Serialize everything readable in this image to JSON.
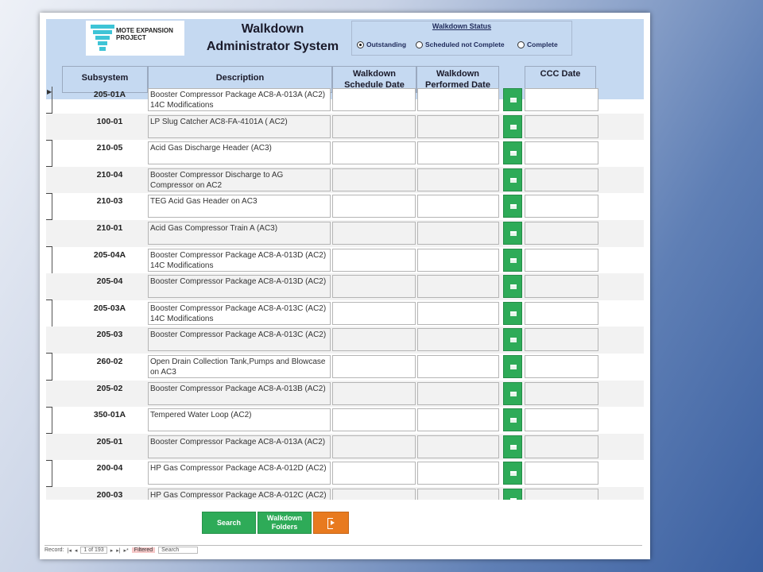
{
  "header": {
    "logo_line1": "MOTE EXPANSION",
    "logo_line2": "PROJECT",
    "title_line1": "Walkdown",
    "title_line2": "Administrator System"
  },
  "status": {
    "title": "Walkdown Status",
    "options": [
      {
        "label": "Outstanding",
        "selected": true
      },
      {
        "label": "Scheduled not Complete",
        "selected": false
      },
      {
        "label": "Complete",
        "selected": false
      }
    ]
  },
  "columns": {
    "subsystem": "Subsystem",
    "description": "Description",
    "schedule_l1": "Walkdown",
    "schedule_l2": "Schedule Date",
    "performed_l1": "Walkdown",
    "performed_l2": "Performed Date",
    "ccc": "CCC Date"
  },
  "rows": [
    {
      "subsystem": "205-01A",
      "description": "Booster Compressor Package AC8-A-013A (AC2) 14C Modifications"
    },
    {
      "subsystem": "100-01",
      "description": "LP Slug Catcher AC8-FA-4101A ( AC2)"
    },
    {
      "subsystem": "210-05",
      "description": "Acid Gas Discharge Header  (AC3)"
    },
    {
      "subsystem": "210-04",
      "description": "Booster Compressor Discharge to AG Compressor on AC2"
    },
    {
      "subsystem": "210-03",
      "description": "TEG Acid Gas Header on AC3"
    },
    {
      "subsystem": "210-01",
      "description": "Acid Gas Compressor Train A  (AC3)"
    },
    {
      "subsystem": "205-04A",
      "description": "Booster Compressor Package AC8-A-013D (AC2) 14C Modifications"
    },
    {
      "subsystem": "205-04",
      "description": "Booster Compressor Package AC8-A-013D (AC2)"
    },
    {
      "subsystem": "205-03A",
      "description": "Booster Compressor Package AC8-A-013C (AC2) 14C Modifications"
    },
    {
      "subsystem": "205-03",
      "description": "Booster Compressor Package AC8-A-013C (AC2)"
    },
    {
      "subsystem": "260-02",
      "description": "Open Drain Collection Tank,Pumps and Blowcase on AC3"
    },
    {
      "subsystem": "205-02",
      "description": "Booster Compressor Package AC8-A-013B (AC2)"
    },
    {
      "subsystem": "350-01A",
      "description": "Tempered Water Loop (AC2)"
    },
    {
      "subsystem": "205-01",
      "description": "Booster Compressor Package AC8-A-013A (AC2)"
    },
    {
      "subsystem": "200-04",
      "description": "HP Gas Compressor Package AC8-A-012D  (AC2)"
    },
    {
      "subsystem": "200-03",
      "description": "HP Gas Compressor Package AC8-A-012C  (AC2)"
    }
  ],
  "buttons": {
    "search": "Search",
    "folders_l1": "Walkdown",
    "folders_l2": "Folders"
  },
  "navbar": {
    "record_label": "Record:",
    "first": "|◂",
    "prev": "◂",
    "position": "1 of 193",
    "next": "▸",
    "last": "▸|",
    "new": "▸*",
    "filtered": "Filtered",
    "search": "Search"
  },
  "colors": {
    "header_bg": "#c5d9f1",
    "button_green": "#2eab58",
    "button_orange": "#e87a1f"
  }
}
